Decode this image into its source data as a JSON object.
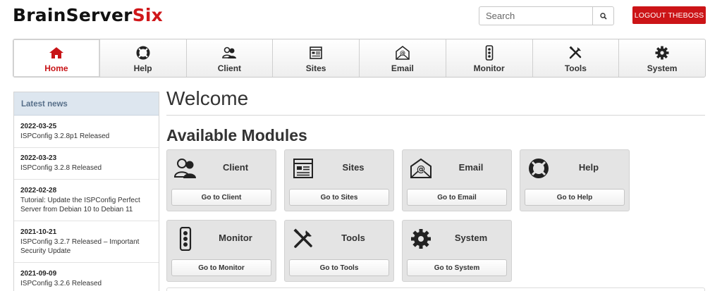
{
  "header": {
    "logo_main": "BrainServer",
    "logo_accent": "Six",
    "search_placeholder": "Search",
    "logout_label": "LOGOUT THEBOSS"
  },
  "nav": {
    "items": [
      {
        "label": "Home",
        "icon": "home-icon"
      },
      {
        "label": "Help",
        "icon": "lifebuoy-icon"
      },
      {
        "label": "Client",
        "icon": "client-icon"
      },
      {
        "label": "Sites",
        "icon": "sites-icon"
      },
      {
        "label": "Email",
        "icon": "email-icon"
      },
      {
        "label": "Monitor",
        "icon": "monitor-icon"
      },
      {
        "label": "Tools",
        "icon": "tools-icon"
      },
      {
        "label": "System",
        "icon": "gear-icon"
      }
    ],
    "active": "Home"
  },
  "sidebar": {
    "title": "Latest news",
    "news": [
      {
        "date": "2022-03-25",
        "title": "ISPConfig 3.2.8p1 Released"
      },
      {
        "date": "2022-03-23",
        "title": "ISPConfig 3.2.8 Released"
      },
      {
        "date": "2022-02-28",
        "title": "Tutorial: Update the ISPConfig Perfect Server from Debian 10 to Debian 11"
      },
      {
        "date": "2021-10-21",
        "title": "ISPConfig 3.2.7 Released – Important Security Update"
      },
      {
        "date": "2021-09-09",
        "title": "ISPConfig 3.2.6 Released"
      }
    ]
  },
  "main": {
    "welcome": "Welcome",
    "modules_heading": "Available Modules",
    "modules": [
      {
        "title": "Client",
        "button": "Go to Client",
        "icon": "client-icon"
      },
      {
        "title": "Sites",
        "button": "Go to Sites",
        "icon": "sites-icon"
      },
      {
        "title": "Email",
        "button": "Go to Email",
        "icon": "email-icon"
      },
      {
        "title": "Help",
        "button": "Go to Help",
        "icon": "lifebuoy-icon"
      },
      {
        "title": "Monitor",
        "button": "Go to Monitor",
        "icon": "monitor-icon"
      },
      {
        "title": "Tools",
        "button": "Go to Tools",
        "icon": "tools-icon"
      },
      {
        "title": "System",
        "button": "Go to System",
        "icon": "gear-icon"
      }
    ]
  },
  "colors": {
    "accent": "#cc1417",
    "sidebar_header_bg": "#dde6ef",
    "module_bg": "#e4e4e4"
  }
}
